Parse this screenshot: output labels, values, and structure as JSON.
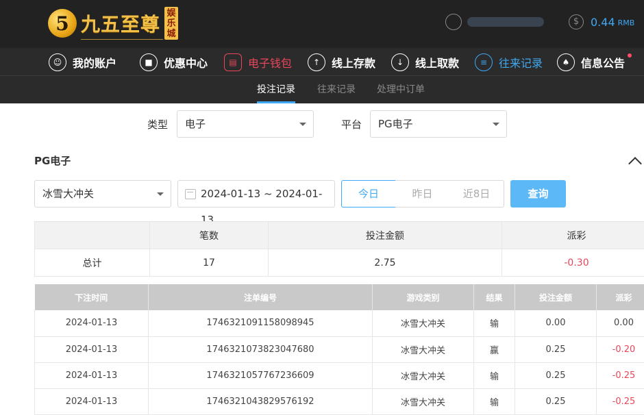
{
  "header": {
    "logo_mark": "5",
    "logo_text": "九五至尊",
    "logo_sub": "娱乐城",
    "username": "",
    "balance": "0.44",
    "currency": "RMB"
  },
  "nav": [
    {
      "label": "我的账户",
      "icon": "user-icon"
    },
    {
      "label": "优惠中心",
      "icon": "gift-icon"
    },
    {
      "label": "电子钱包",
      "icon": "wallet-icon"
    },
    {
      "label": "线上存款",
      "icon": "deposit-icon"
    },
    {
      "label": "线上取款",
      "icon": "withdraw-icon"
    },
    {
      "label": "往来记录",
      "icon": "records-icon"
    },
    {
      "label": "信息公告",
      "icon": "bell-icon"
    }
  ],
  "subtabs": [
    "投注记录",
    "往来记录",
    "处理中订单"
  ],
  "filters": {
    "type_label": "类型",
    "type_value": "电子",
    "platform_label": "平台",
    "platform_value": "PG电子"
  },
  "section_title": "PG电子",
  "query": {
    "game_value": "冰雪大冲关",
    "date_range": "2024-01-13 ~ 2024-01-13",
    "today": "今日",
    "yesterday": "昨日",
    "last8": "近8日",
    "submit": "查询"
  },
  "summary": {
    "headers": [
      "",
      "笔数",
      "投注金额",
      "派彩"
    ],
    "row": [
      "总计",
      "17",
      "2.75",
      "-0.30"
    ]
  },
  "records": {
    "headers": [
      "下注时间",
      "注单编号",
      "游戏类别",
      "结果",
      "投注金额",
      "派彩"
    ],
    "rows": [
      [
        "2024-01-13",
        "1746321091158098945",
        "冰雪大冲关",
        "输",
        "0.00",
        "0.00"
      ],
      [
        "2024-01-13",
        "1746321073823047680",
        "冰雪大冲关",
        "赢",
        "0.25",
        "-0.20"
      ],
      [
        "2024-01-13",
        "1746321057767236609",
        "冰雪大冲关",
        "输",
        "0.25",
        "-0.25"
      ],
      [
        "2024-01-13",
        "1746321043829576192",
        "冰雪大冲关",
        "输",
        "0.25",
        "-0.25"
      ]
    ]
  },
  "colors": {
    "accent": "#3fa9f5",
    "negative": "#e8475a",
    "header_bg": "#222222"
  }
}
